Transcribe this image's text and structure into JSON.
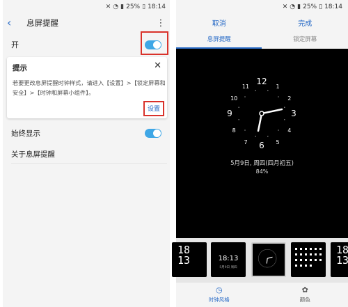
{
  "left": {
    "status": {
      "battery": "25%",
      "time": "18:14"
    },
    "header": {
      "back_icon": "chevron-left-icon",
      "title": "息屏提醒",
      "more_icon": "more-vert-icon"
    },
    "on_row": {
      "label": "开",
      "toggle": true
    },
    "tip": {
      "title": "提示",
      "text": "若要更改息屏提醒时钟样式，请进入【设置】>【锁定屏幕和安全】>【时钟和屏幕小组件】。",
      "setting_button": "设置"
    },
    "always_on": {
      "label": "始终显示",
      "toggle": true
    },
    "about": {
      "label": "关于息屏提醒"
    }
  },
  "right": {
    "status": {
      "battery": "25%",
      "time": "18:14"
    },
    "header": {
      "cancel": "取消",
      "done": "完成"
    },
    "tabs": [
      {
        "label": "息屏提醒",
        "active": true
      },
      {
        "label": "锁定屏幕",
        "active": false
      }
    ],
    "aod": {
      "clock_numbers": [
        "12",
        "1",
        "2",
        "3",
        "4",
        "5",
        "6",
        "7",
        "8",
        "9",
        "10",
        "11"
      ],
      "date": "5月9日, 周四(四月初五)",
      "battery": "84%"
    },
    "thumbnails": [
      {
        "big": "18\n13",
        "selected": false
      },
      {
        "mid": "18:13",
        "sub": "5月9日 周四",
        "selected": false
      },
      {
        "selected": true
      },
      {
        "selected": false
      },
      {
        "big": "18\n13",
        "selected": false
      }
    ],
    "bottom_nav": [
      {
        "icon": "clock-icon",
        "label": "时钟风格",
        "active": true
      },
      {
        "icon": "palette-icon",
        "label": "颜色",
        "active": false
      }
    ]
  },
  "colors": {
    "accent": "#2a6cc7",
    "toggle": "#3fa7e6",
    "highlight": "#d9322b"
  }
}
